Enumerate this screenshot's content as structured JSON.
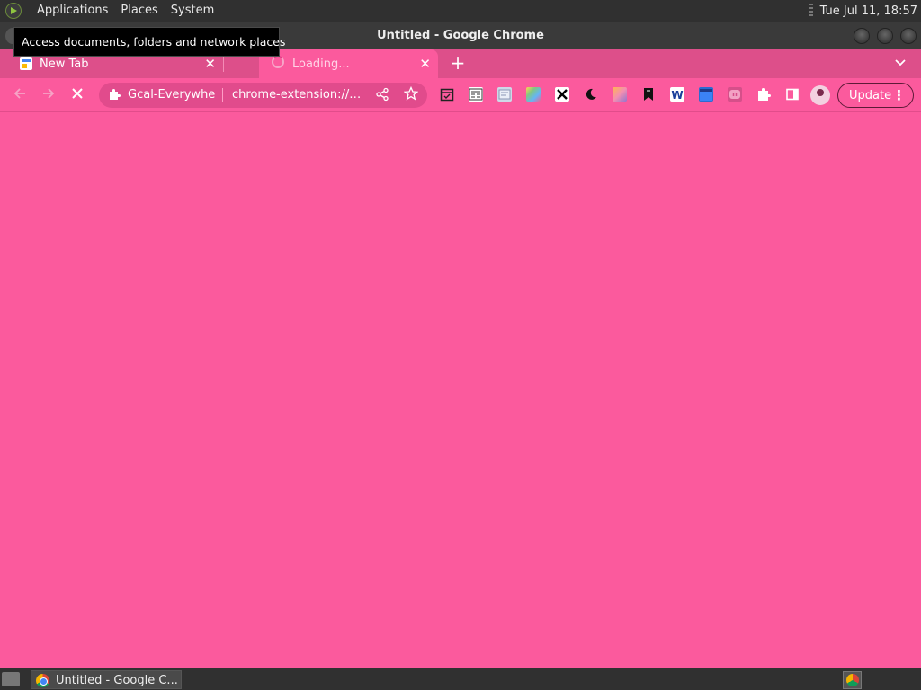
{
  "top_panel": {
    "menus": [
      "Applications",
      "Places",
      "System"
    ],
    "clock": "Tue Jul 11, 18:57"
  },
  "window": {
    "title": "Untitled - Google Chrome"
  },
  "tooltip": {
    "text": "Access documents, folders and network places"
  },
  "tabs": [
    {
      "label": "New Tab",
      "active": false
    },
    {
      "label": "Loading...",
      "active": true
    }
  ],
  "toolbar": {
    "omnibox": {
      "site_name": "Gcal-Everywher",
      "url": "chrome-extension://g..."
    },
    "update_label": "Update",
    "extensions": [
      "calendar-icon",
      "reader-icon",
      "translate-icon",
      "color-palette-icon",
      "x-icon",
      "moon-icon",
      "gradient-icon",
      "bookmark-icon",
      "word-icon",
      "clapper-icon",
      "pause-icon",
      "puzzle-icon",
      "sidepanel-icon"
    ]
  },
  "taskbar": {
    "task_label": "Untitled - Google C..."
  },
  "colors": {
    "page_background": "#fb5a9d",
    "tabstrip": "#dd4f8a",
    "panel": "#303030"
  }
}
